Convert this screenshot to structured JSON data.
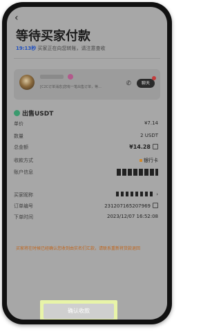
{
  "nav": {
    "back_glyph": "‹"
  },
  "header": {
    "title": "等待买家付款",
    "countdown": "19:13秒",
    "status_text": "买家正在向您转账，请注意查收"
  },
  "merchant": {
    "message": "[C2C订单消息]您有一笔出售订单，等...",
    "chat_label": "聊天"
  },
  "order": {
    "sell_label": "出售USDT",
    "rows": [
      {
        "label": "单价",
        "value": "¥7.14"
      },
      {
        "label": "数量",
        "value": "2 USDT"
      },
      {
        "label": "总金额",
        "value": "¥14.28"
      },
      {
        "label": "收款方式",
        "value": "银行卡"
      },
      {
        "label": "账户信息",
        "value": ""
      },
      {
        "label": "买家昵称",
        "value": ""
      },
      {
        "label": "订单编号",
        "value": "231207165207969"
      },
      {
        "label": "下单时间",
        "value": "2023/12/07 16:52:08"
      }
    ]
  },
  "notice": "买家将在时候已经确认您收到由实名们汇款，请联系重新将货款退回",
  "confirm_button": "确认收款",
  "colors": {
    "countdown": "#1f4fbf",
    "notice": "#c0641a",
    "highlight": "#e8f4a8"
  }
}
